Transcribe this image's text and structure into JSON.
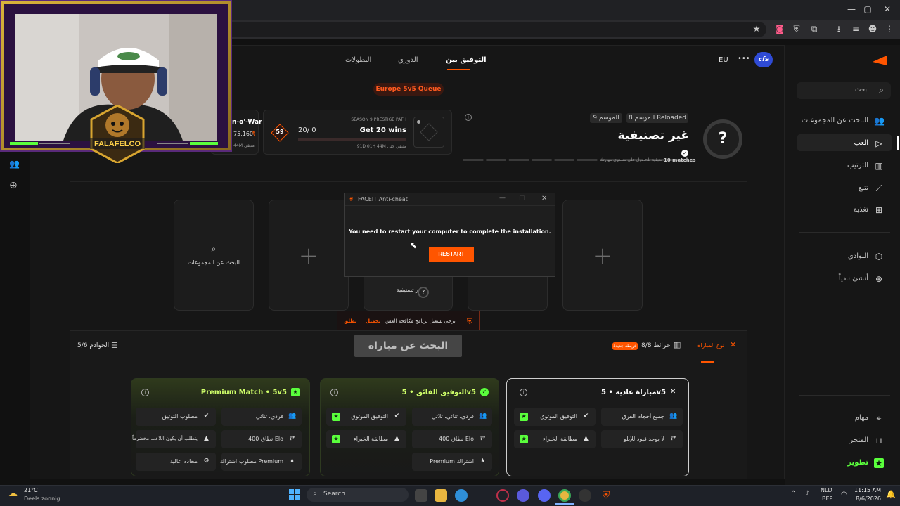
{
  "browser": {
    "window_controls": [
      "—",
      "▢",
      "✕"
    ]
  },
  "nav": {
    "region": "EU",
    "more": "•••",
    "logo_text": "cfs",
    "tabs": [
      {
        "label": "التوفيق بين",
        "active": true
      },
      {
        "label": "الدوري",
        "active": false
      },
      {
        "label": "البطولات",
        "active": false
      }
    ],
    "queue_label": "Europe 5v5 Queue"
  },
  "rank": {
    "season_label": "الموسم 8 Reloaded",
    "season9": "الموسم 9",
    "title": "غير تصنيفية",
    "matches": "10 matches",
    "hint": "متبقية للحصول على مستوى مهارتك",
    "badge": "?"
  },
  "challenge": {
    "season": "SEASON 9 PRESTIGE PATH",
    "goal": "Get 20 wins",
    "progress": "20/ 0",
    "progress_fraction": 0,
    "remaining": "91D 01H 44M متبقي حتى",
    "level": "59"
  },
  "left_challenge": {
    "title": "n-o'-War",
    "points": "75,160",
    "remaining": "3H 44M متبقي"
  },
  "search_slot": {
    "label": "البحث عن المجموعات"
  },
  "player_slot": {
    "rank_label": "غير تصنيفية"
  },
  "dialog": {
    "title": "FACEIT Anti-cheat",
    "message": "You need to restart your computer to complete the installation.",
    "button": "RESTART"
  },
  "warning": {
    "text": "يرجى تشغيل برنامج مكافحة الغش",
    "download": "تحميل",
    "launch": "يطلق"
  },
  "bottom": {
    "servers": "الخوادم 5/6",
    "find_match": "البحث عن مباراة",
    "maps": "خرائط 8/8",
    "maps_badge": "خريطة جديدة",
    "match_type": "نوع المباراة"
  },
  "modes": [
    {
      "title": "مباراة عادية • 5v5",
      "chips": [
        {
          "text": "جميع أحجام الفرق",
          "icon": "👥"
        },
        {
          "text": "التوفيق الموثوق",
          "icon": "✔",
          "green": true
        },
        {
          "text": "لا يوجد قيود للإيلو",
          "icon": "⇄"
        },
        {
          "text": "مطابقة الخبراء",
          "icon": "▲",
          "green": true
        }
      ]
    },
    {
      "title": "التوفيق الفائق • 5v5",
      "chips": [
        {
          "text": "فردي، ثنائي، ثلاثي",
          "icon": "👥"
        },
        {
          "text": "التوفيق الموثوق",
          "icon": "✔",
          "green": true
        },
        {
          "text": "نطاق 400 Elo",
          "icon": "⇄"
        },
        {
          "text": "مطابقة الخبراء",
          "icon": "▲",
          "green": true
        },
        {
          "text": "Premium اشتراك",
          "icon": "★"
        }
      ]
    },
    {
      "title": "Premium Match • 5v5",
      "chips": [
        {
          "text": "فردي، ثنائي",
          "icon": "👥"
        },
        {
          "text": "مطلوب التوثيق",
          "icon": "✔"
        },
        {
          "text": "نطاق 400 Elo",
          "icon": "⇄"
        },
        {
          "text": "يتطلب أن يكون اللاعب مخضرماً",
          "icon": "▲"
        },
        {
          "text": "مطلوب اشتراك Premium",
          "icon": "★"
        },
        {
          "text": "مخادم عالية",
          "icon": "⚙"
        }
      ]
    }
  ],
  "sidebar": {
    "search_placeholder": "بحث",
    "items": [
      {
        "label": "الباحث عن المجموعات",
        "icon": "group-icon"
      },
      {
        "label": "العب",
        "icon": "play-icon",
        "active": true
      },
      {
        "label": "الترتيب",
        "icon": "ranking-icon"
      },
      {
        "label": "تتبع",
        "icon": "track-icon"
      },
      {
        "label": "تغذية",
        "icon": "feed-icon"
      },
      {
        "label": "النوادي",
        "icon": "clubs-icon"
      },
      {
        "label": "أنشئ نادياً",
        "icon": "create-club-icon"
      },
      {
        "label": "مهام",
        "icon": "missions-icon"
      },
      {
        "label": "المتجر",
        "icon": "shop-icon"
      },
      {
        "label": "تطوير",
        "icon": "upgrade-icon"
      }
    ]
  },
  "webcam": {
    "logo_text": "FALAFELCO"
  },
  "taskbar": {
    "weather_temp": "21°C",
    "weather_desc": "Deels zonnig",
    "search": "Search",
    "lang": "NLD",
    "lang2": "BEP",
    "time": "11:15 AM",
    "date": "8/6/2026"
  },
  "colors": {
    "accent": "#ff5500",
    "green": "#5aff3c",
    "background": "#121212"
  }
}
